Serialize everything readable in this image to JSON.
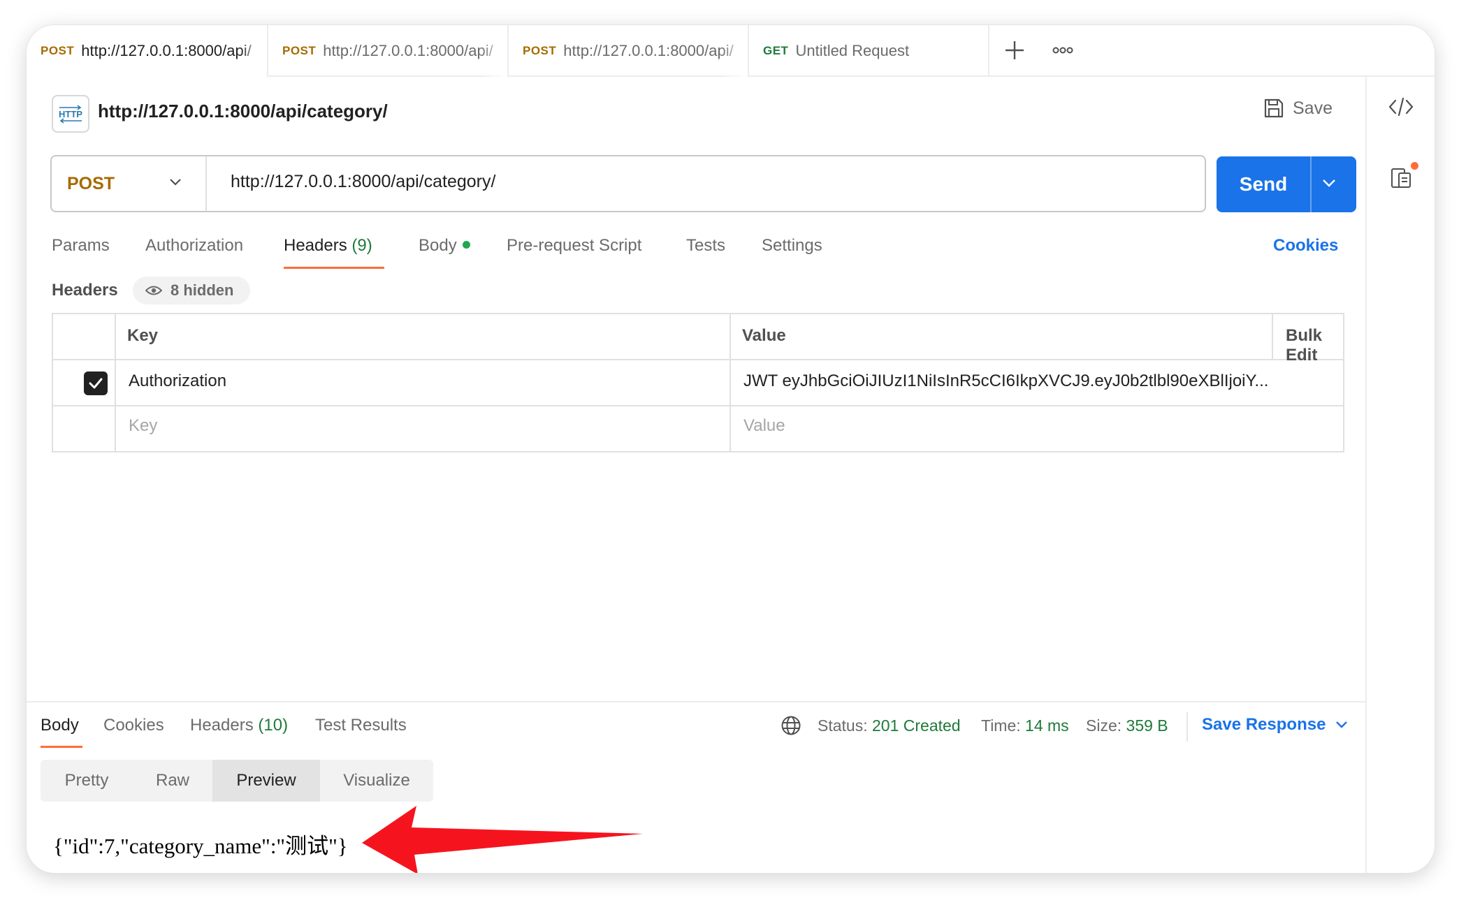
{
  "tabs": [
    {
      "method": "POST",
      "url": "http://127.0.0.1:8000/api/"
    },
    {
      "method": "POST",
      "url": "http://127.0.0.1:8000/api/"
    },
    {
      "method": "POST",
      "url": "http://127.0.0.1:8000/api/"
    },
    {
      "method": "GET",
      "url": "Untitled Request"
    }
  ],
  "request": {
    "title": "http://127.0.0.1:8000/api/category/",
    "save_label": "Save",
    "method": "POST",
    "url": "http://127.0.0.1:8000/api/category/",
    "send_label": "Send",
    "badge": "HTTP"
  },
  "request_tabs": {
    "params": "Params",
    "authorization": "Authorization",
    "headers": "Headers",
    "headers_count": "(9)",
    "body": "Body",
    "pre_request": "Pre-request Script",
    "tests": "Tests",
    "settings": "Settings",
    "cookies": "Cookies"
  },
  "headers_section": {
    "label": "Headers",
    "hidden": "8 hidden",
    "col_key": "Key",
    "col_value": "Value",
    "bulk_edit": "Bulk Edit",
    "rows": [
      {
        "checked": true,
        "key": "Authorization",
        "value": "JWT eyJhbGciOiJIUzI1NiIsInR5cCI6IkpXVCJ9.eyJ0b2tlbl90eXBlIjoiY..."
      }
    ],
    "placeholder_key": "Key",
    "placeholder_value": "Value"
  },
  "response": {
    "tabs": {
      "body": "Body",
      "cookies": "Cookies",
      "headers": "Headers",
      "headers_count": "(10)",
      "test_results": "Test Results"
    },
    "status_label": "Status:",
    "status_value": "201 Created",
    "time_label": "Time:",
    "time_value": "14 ms",
    "size_label": "Size:",
    "size_value": "359 B",
    "save_response": "Save Response",
    "views": [
      "Pretty",
      "Raw",
      "Preview",
      "Visualize"
    ],
    "active_view": "Preview",
    "body": "{\"id\":7,\"category_name\":\"测试\"}"
  },
  "colors": {
    "accent": "#ff6c37",
    "send": "#1a73e8",
    "post": "#a66a00",
    "get": "#1f7a3a",
    "status_ok": "#1f7a3a",
    "arrow": "#f5141e"
  },
  "icons": [
    "plus-icon",
    "more-icon",
    "code-icon",
    "doc-icon",
    "save-icon",
    "chevron-down-icon",
    "eye-icon",
    "check-icon",
    "globe-icon"
  ]
}
